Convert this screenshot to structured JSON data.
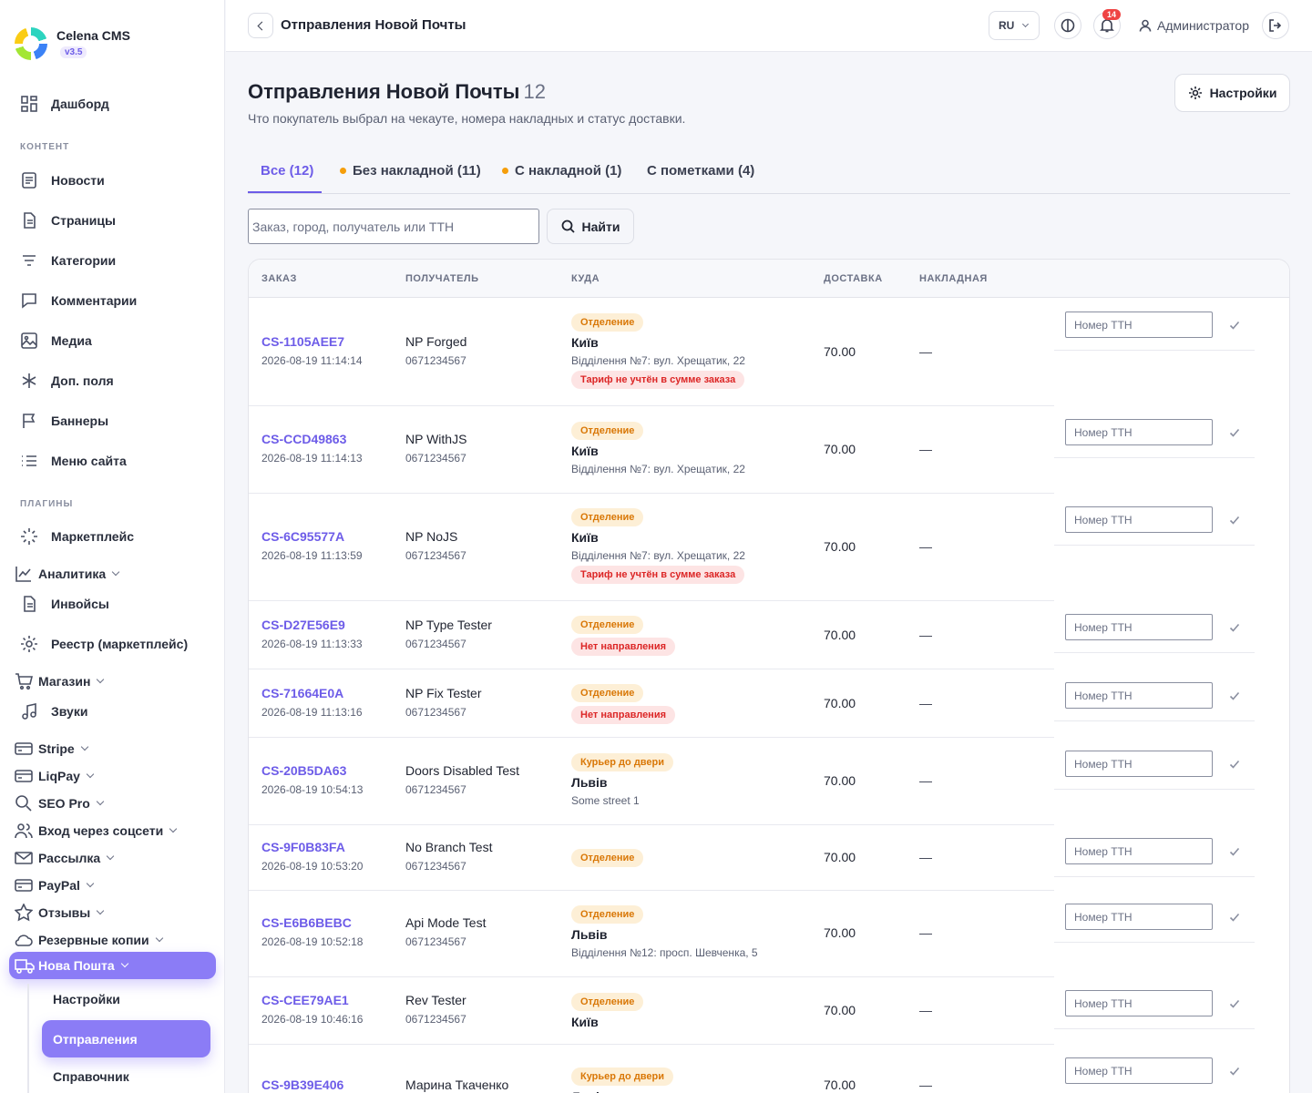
{
  "brand": {
    "name": "Celena CMS",
    "version": "v3.5"
  },
  "sidebar": {
    "items": [
      {
        "label": "Дашборд",
        "icon": "grid-icon"
      },
      {
        "label": "Новости",
        "icon": "news-icon"
      },
      {
        "label": "Страницы",
        "icon": "page-icon"
      },
      {
        "label": "Категории",
        "icon": "filter-icon"
      },
      {
        "label": "Комментарии",
        "icon": "comment-icon"
      },
      {
        "label": "Медиа",
        "icon": "image-icon"
      },
      {
        "label": "Доп. поля",
        "icon": "asterisk-icon"
      },
      {
        "label": "Баннеры",
        "icon": "flag-icon"
      },
      {
        "label": "Меню сайта",
        "icon": "list-icon"
      },
      {
        "label": "Маркетплейс",
        "icon": "loader-icon"
      },
      {
        "label": "Аналитика",
        "icon": "chart-icon"
      },
      {
        "label": "Инвойсы",
        "icon": "invoice-icon"
      },
      {
        "label": "Реестр (маркетплейс)",
        "icon": "gear-icon"
      },
      {
        "label": "Магазин",
        "icon": "cart-icon"
      },
      {
        "label": "Звуки",
        "icon": "music-icon"
      },
      {
        "label": "Stripe",
        "icon": "card-icon"
      },
      {
        "label": "LiqPay",
        "icon": "card-icon"
      },
      {
        "label": "SEO Pro",
        "icon": "search-icon"
      },
      {
        "label": "Вход через соцсети",
        "icon": "users-icon"
      },
      {
        "label": "Рассылка",
        "icon": "mail-icon"
      },
      {
        "label": "PayPal",
        "icon": "card-icon"
      },
      {
        "label": "Отзывы",
        "icon": "star-icon"
      },
      {
        "label": "Резервные копии",
        "icon": "cloud-icon"
      }
    ],
    "section_content": "КОНТЕНТ",
    "section_plugins": "ПЛАГИНЫ",
    "active_group": "Нова Пошта",
    "sub_items": [
      "Настройки",
      "Отправления",
      "Справочник"
    ]
  },
  "header": {
    "title": "Отправления Новой Почты",
    "lang": "RU",
    "notifications": "14",
    "user": "Администратор"
  },
  "main": {
    "title": "Отправления Новой Почты",
    "count": "12",
    "subtitle": "Что покупатель выбрал на чекауте, номера накладных и статус доставки.",
    "settings_label": "Настройки",
    "tabs": [
      "Все (12)",
      "Без накладной (11)",
      "С накладной (1)",
      "С пометками (4)"
    ],
    "search_placeholder": "Заказ, город, получатель или ТТН",
    "find_label": "Найти",
    "columns": [
      "ЗАКАЗ",
      "ПОЛУЧАТЕЛЬ",
      "КУДА",
      "ДОСТАВКА",
      "НАКЛАДНАЯ"
    ],
    "tth_placeholder": "Номер ТТН",
    "rows": [
      {
        "id": "CS-1105AEE7",
        "date": "2026-08-19 11:14:14",
        "name": "NP Forged",
        "phone": "0671234567",
        "type": "Отделение",
        "city": "Київ",
        "address": "Відділення №7: вул. Хрещатик, 22",
        "warn": "Тариф не учтён в сумме заказа",
        "delivery": "70.00",
        "waybill": "—"
      },
      {
        "id": "CS-CCD49863",
        "date": "2026-08-19 11:14:13",
        "name": "NP WithJS",
        "phone": "0671234567",
        "type": "Отделение",
        "city": "Київ",
        "address": "Відділення №7: вул. Хрещатик, 22",
        "warn": "",
        "delivery": "70.00",
        "waybill": "—"
      },
      {
        "id": "CS-6C95577A",
        "date": "2026-08-19 11:13:59",
        "name": "NP NoJS",
        "phone": "0671234567",
        "type": "Отделение",
        "city": "Київ",
        "address": "Відділення №7: вул. Хрещатик, 22",
        "warn": "Тариф не учтён в сумме заказа",
        "delivery": "70.00",
        "waybill": "—"
      },
      {
        "id": "CS-D27E56E9",
        "date": "2026-08-19 11:13:33",
        "name": "NP Type Tester",
        "phone": "0671234567",
        "type": "Отделение",
        "city": "",
        "address": "",
        "warn": "Нет направления",
        "delivery": "70.00",
        "waybill": "—"
      },
      {
        "id": "CS-71664E0A",
        "date": "2026-08-19 11:13:16",
        "name": "NP Fix Tester",
        "phone": "0671234567",
        "type": "Отделение",
        "city": "",
        "address": "",
        "warn": "Нет направления",
        "delivery": "70.00",
        "waybill": "—"
      },
      {
        "id": "CS-20B5DA63",
        "date": "2026-08-19 10:54:13",
        "name": "Doors Disabled Test",
        "phone": "0671234567",
        "type": "Курьер до двери",
        "city": "Львів",
        "address": "Some street 1",
        "warn": "",
        "delivery": "70.00",
        "waybill": "—"
      },
      {
        "id": "CS-9F0B83FA",
        "date": "2026-08-19 10:53:20",
        "name": "No Branch Test",
        "phone": "0671234567",
        "type": "Отделение",
        "city": "",
        "address": "",
        "warn": "",
        "delivery": "70.00",
        "waybill": "—"
      },
      {
        "id": "CS-E6B6BEBC",
        "date": "2026-08-19 10:52:18",
        "name": "Api Mode Test",
        "phone": "0671234567",
        "type": "Отделение",
        "city": "Львів",
        "address": "Відділення №12: просп. Шевченка, 5",
        "warn": "",
        "delivery": "70.00",
        "waybill": "—"
      },
      {
        "id": "CS-CEE79AE1",
        "date": "2026-08-19 10:46:16",
        "name": "Rev Tester",
        "phone": "0671234567",
        "type": "Отделение",
        "city": "Київ",
        "address": "",
        "warn": "",
        "delivery": "70.00",
        "waybill": "—"
      },
      {
        "id": "CS-9B39E406",
        "date": "",
        "name": "Марина Ткаченко",
        "phone": "",
        "type": "Курьер до двери",
        "city": "Львів",
        "address": "",
        "warn": "",
        "delivery": "70.00",
        "waybill": "—"
      }
    ]
  }
}
